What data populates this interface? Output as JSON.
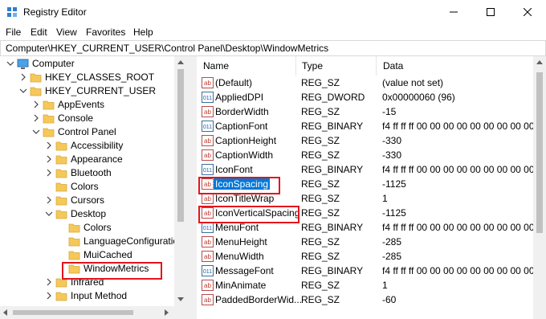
{
  "window": {
    "title": "Registry Editor",
    "icon": "registry-editor-icon",
    "minimize_icon": "minimize-icon",
    "maximize_icon": "maximize-icon",
    "close_icon": "close-icon"
  },
  "menubar": {
    "items": [
      "File",
      "Edit",
      "View",
      "Favorites",
      "Help"
    ]
  },
  "address": {
    "path": "Computer\\HKEY_CURRENT_USER\\Control Panel\\Desktop\\WindowMetrics"
  },
  "tree": {
    "items": [
      {
        "label": "Computer",
        "state": "expanded",
        "icon": "computer-icon"
      },
      {
        "label": "HKEY_CLASSES_ROOT",
        "state": "collapsed",
        "icon": "folder-icon"
      },
      {
        "label": "HKEY_CURRENT_USER",
        "state": "expanded",
        "icon": "folder-icon"
      },
      {
        "label": "AppEvents",
        "state": "collapsed",
        "icon": "folder-icon"
      },
      {
        "label": "Console",
        "state": "collapsed",
        "icon": "folder-icon"
      },
      {
        "label": "Control Panel",
        "state": "expanded",
        "icon": "folder-icon"
      },
      {
        "label": "Accessibility",
        "state": "collapsed",
        "icon": "folder-icon"
      },
      {
        "label": "Appearance",
        "state": "collapsed",
        "icon": "folder-icon"
      },
      {
        "label": "Bluetooth",
        "state": "collapsed",
        "icon": "folder-icon"
      },
      {
        "label": "Colors",
        "state": "leaf",
        "icon": "folder-icon"
      },
      {
        "label": "Cursors",
        "state": "collapsed",
        "icon": "folder-icon"
      },
      {
        "label": "Desktop",
        "state": "expanded",
        "icon": "folder-icon"
      },
      {
        "label": "Colors",
        "state": "leaf",
        "icon": "folder-icon"
      },
      {
        "label": "LanguageConfiguration",
        "state": "leaf",
        "icon": "folder-icon"
      },
      {
        "label": "MuiCached",
        "state": "leaf",
        "icon": "folder-icon"
      },
      {
        "label": "WindowMetrics",
        "state": "selected",
        "icon": "folder-icon"
      },
      {
        "label": "Infrared",
        "state": "collapsed",
        "icon": "folder-icon"
      },
      {
        "label": "Input Method",
        "state": "collapsed",
        "icon": "folder-icon"
      }
    ]
  },
  "list": {
    "headers": {
      "name": "Name",
      "type": "Type",
      "data": "Data"
    },
    "rows": [
      {
        "name": "(Default)",
        "type": "REG_SZ",
        "data": "(value not set)",
        "kind": "string"
      },
      {
        "name": "AppliedDPI",
        "type": "REG_DWORD",
        "data": "0x00000060 (96)",
        "kind": "binary"
      },
      {
        "name": "BorderWidth",
        "type": "REG_SZ",
        "data": "-15",
        "kind": "string"
      },
      {
        "name": "CaptionFont",
        "type": "REG_BINARY",
        "data": "f4 ff ff ff 00 00 00 00 00 00 00 00 00",
        "kind": "binary"
      },
      {
        "name": "CaptionHeight",
        "type": "REG_SZ",
        "data": "-330",
        "kind": "string"
      },
      {
        "name": "CaptionWidth",
        "type": "REG_SZ",
        "data": "-330",
        "kind": "string"
      },
      {
        "name": "IconFont",
        "type": "REG_BINARY",
        "data": "f4 ff ff ff 00 00 00 00 00 00 00 00 00",
        "kind": "binary"
      },
      {
        "name": "IconSpacing",
        "type": "REG_SZ",
        "data": "-1125",
        "kind": "string",
        "selected": true
      },
      {
        "name": "IconTitleWrap",
        "type": "REG_SZ",
        "data": "1",
        "kind": "string"
      },
      {
        "name": "IconVerticalSpacing",
        "type": "REG_SZ",
        "data": "-1125",
        "kind": "string"
      },
      {
        "name": "MenuFont",
        "type": "REG_BINARY",
        "data": "f4 ff ff ff 00 00 00 00 00 00 00 00 00",
        "kind": "binary"
      },
      {
        "name": "MenuHeight",
        "type": "REG_SZ",
        "data": "-285",
        "kind": "string"
      },
      {
        "name": "MenuWidth",
        "type": "REG_SZ",
        "data": "-285",
        "kind": "string"
      },
      {
        "name": "MessageFont",
        "type": "REG_BINARY",
        "data": "f4 ff ff ff 00 00 00 00 00 00 00 00 00",
        "kind": "binary"
      },
      {
        "name": "MinAnimate",
        "type": "REG_SZ",
        "data": "1",
        "kind": "string"
      },
      {
        "name": "PaddedBorderWid...",
        "type": "REG_SZ",
        "data": "-60",
        "kind": "string"
      }
    ]
  },
  "colors": {
    "accent": "#0078d7",
    "highlight_box": "#e3141c",
    "folder": "#f5c85a"
  }
}
